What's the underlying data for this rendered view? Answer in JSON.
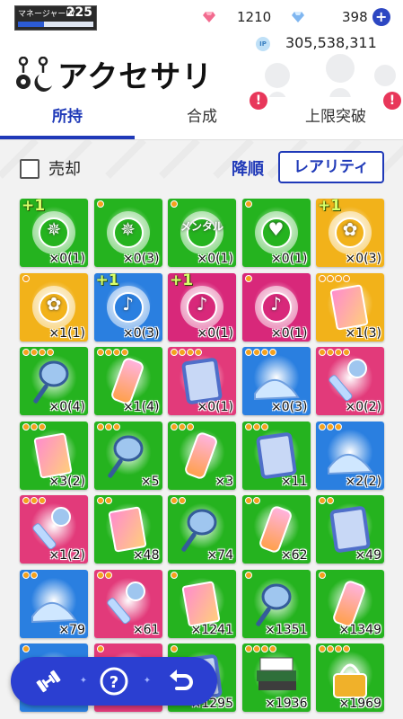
{
  "status": {
    "manager_label": "マネージャーLV",
    "manager_level": "225",
    "manager_progress": 0.35,
    "gem_paid": "1210",
    "gem_free": "398",
    "ip_label": "IP",
    "ip_value": "305,538,311"
  },
  "page": {
    "title": "アクセサリ",
    "icon": "accessory-earring-icon"
  },
  "tabs": [
    {
      "label": "所持",
      "active": true,
      "alert": false
    },
    {
      "label": "合成",
      "active": false,
      "alert": true
    },
    {
      "label": "上限突破",
      "active": false,
      "alert": true
    }
  ],
  "alert_mark": "!",
  "toolbar": {
    "sell_label": "売却",
    "sort_order": "降順",
    "sort_key": "レアリティ"
  },
  "items": [
    {
      "kind": "burst",
      "color": "#25b31f",
      "plus": true,
      "stars": 0,
      "glyph": "✵",
      "count": "×0(1)"
    },
    {
      "kind": "burst",
      "color": "#25b31f",
      "plus": false,
      "stars": 1,
      "glyph": "✵",
      "count": "×0(3)"
    },
    {
      "kind": "burst",
      "color": "#25b31f",
      "plus": false,
      "stars": 1,
      "glyph": "メンタル",
      "count": "×0(1)"
    },
    {
      "kind": "burst",
      "color": "#25b31f",
      "plus": false,
      "stars": 1,
      "glyph": "♥",
      "count": "×0(1)"
    },
    {
      "kind": "burst",
      "color": "#f2b21a",
      "plus": true,
      "stars": 0,
      "glyph": "✿",
      "count": "×0(3)"
    },
    {
      "kind": "burst",
      "color": "#f2b21a",
      "plus": false,
      "stars": 1,
      "glyph": "✿",
      "count": "×1(1)"
    },
    {
      "kind": "burst",
      "color": "#2a7fe0",
      "plus": true,
      "stars": 0,
      "glyph": "♪",
      "count": "×0(3)"
    },
    {
      "kind": "burst",
      "color": "#d8287a",
      "plus": true,
      "stars": 0,
      "glyph": "♪",
      "count": "×0(1)"
    },
    {
      "kind": "burst",
      "color": "#d8287a",
      "plus": false,
      "stars": 1,
      "glyph": "♪",
      "count": "×0(1)"
    },
    {
      "kind": "card",
      "color": "#f2b21a",
      "plus": false,
      "stars": 4,
      "glyph": "tablet",
      "count": "×1(3)"
    },
    {
      "kind": "card",
      "color": "#25b31f",
      "plus": false,
      "stars": 4,
      "glyph": "racket",
      "count": "×0(4)"
    },
    {
      "kind": "card",
      "color": "#25b31f",
      "plus": false,
      "stars": 4,
      "glyph": "bottle",
      "count": "×1(4)"
    },
    {
      "kind": "card",
      "color": "#e23a7a",
      "plus": false,
      "stars": 4,
      "glyph": "mirror",
      "count": "×0(1)"
    },
    {
      "kind": "card",
      "color": "#2a7fe0",
      "plus": false,
      "stars": 4,
      "glyph": "shoe",
      "count": "×0(3)"
    },
    {
      "kind": "card",
      "color": "#e23a7a",
      "plus": false,
      "stars": 4,
      "glyph": "mic",
      "count": "×0(2)"
    },
    {
      "kind": "card",
      "color": "#25b31f",
      "plus": false,
      "stars": 3,
      "glyph": "tablet",
      "count": "×3(2)"
    },
    {
      "kind": "card",
      "color": "#25b31f",
      "plus": false,
      "stars": 3,
      "glyph": "racket",
      "count": "×5"
    },
    {
      "kind": "card",
      "color": "#25b31f",
      "plus": false,
      "stars": 3,
      "glyph": "bottle",
      "count": "×3"
    },
    {
      "kind": "card",
      "color": "#25b31f",
      "plus": false,
      "stars": 3,
      "glyph": "mirror",
      "count": "×11"
    },
    {
      "kind": "card",
      "color": "#2a7fe0",
      "plus": false,
      "stars": 3,
      "glyph": "shoe",
      "count": "×2(2)"
    },
    {
      "kind": "card",
      "color": "#e23a7a",
      "plus": false,
      "stars": 3,
      "glyph": "mic",
      "count": "×1(2)"
    },
    {
      "kind": "card",
      "color": "#25b31f",
      "plus": false,
      "stars": 2,
      "glyph": "tablet",
      "count": "×48"
    },
    {
      "kind": "card",
      "color": "#25b31f",
      "plus": false,
      "stars": 2,
      "glyph": "racket",
      "count": "×74"
    },
    {
      "kind": "card",
      "color": "#25b31f",
      "plus": false,
      "stars": 2,
      "glyph": "bottle",
      "count": "×62"
    },
    {
      "kind": "card",
      "color": "#25b31f",
      "plus": false,
      "stars": 2,
      "glyph": "mirror",
      "count": "×49"
    },
    {
      "kind": "card",
      "color": "#2a7fe0",
      "plus": false,
      "stars": 2,
      "glyph": "shoe",
      "count": "×79"
    },
    {
      "kind": "card",
      "color": "#e23a7a",
      "plus": false,
      "stars": 2,
      "glyph": "mic",
      "count": "×61"
    },
    {
      "kind": "card",
      "color": "#25b31f",
      "plus": false,
      "stars": 1,
      "glyph": "tablet",
      "count": "×1241"
    },
    {
      "kind": "card",
      "color": "#25b31f",
      "plus": false,
      "stars": 1,
      "glyph": "racket",
      "count": "×1351"
    },
    {
      "kind": "card",
      "color": "#25b31f",
      "plus": false,
      "stars": 1,
      "glyph": "bottle",
      "count": "×1349"
    },
    {
      "kind": "card",
      "color": "#2a7fe0",
      "plus": false,
      "stars": 1,
      "glyph": "",
      "count": ""
    },
    {
      "kind": "card",
      "color": "#e23a7a",
      "plus": false,
      "stars": 1,
      "glyph": "",
      "count": ""
    },
    {
      "kind": "card",
      "color": "#25b31f",
      "plus": false,
      "stars": 1,
      "glyph": "mirror",
      "count": "×1295"
    },
    {
      "kind": "card",
      "color": "#25b31f",
      "plus": false,
      "stars": 4,
      "glyph": "books",
      "count": "×1936"
    },
    {
      "kind": "card",
      "color": "#25b31f",
      "plus": false,
      "stars": 4,
      "glyph": "bag",
      "count": "×1969"
    }
  ],
  "fab": {
    "buttons": [
      {
        "name": "training-dumbbell-icon",
        "symbol": "dumbbell"
      },
      {
        "name": "help-question-icon",
        "symbol": "?"
      },
      {
        "name": "back-arrow-icon",
        "symbol": "back"
      }
    ],
    "separator": "✦"
  }
}
